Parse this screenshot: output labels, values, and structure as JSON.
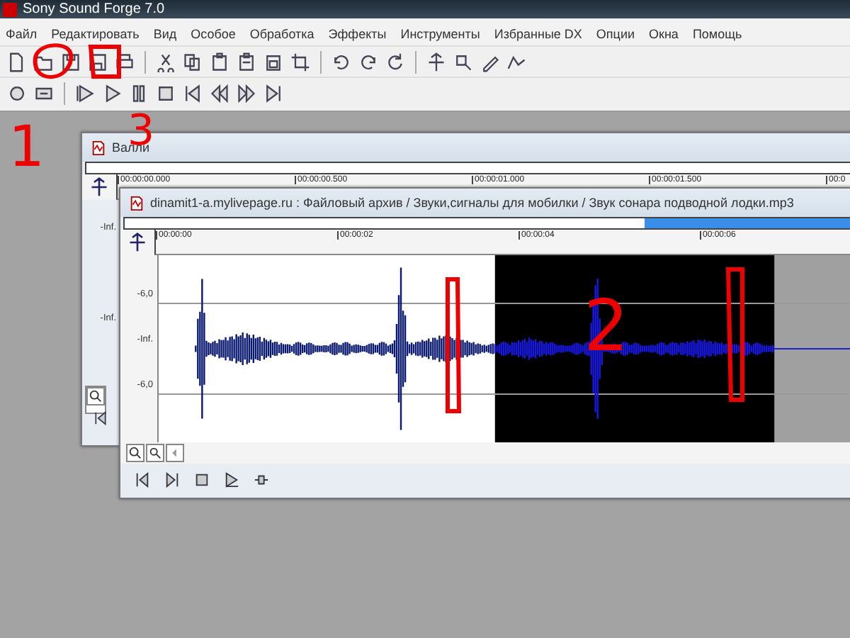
{
  "window": {
    "title": "Sony Sound Forge 7.0"
  },
  "menu": [
    "Файл",
    "Редактировать",
    "Вид",
    "Особое",
    "Обработка",
    "Эффекты",
    "Инструменты",
    "Избранные DX",
    "Опции",
    "Окна",
    "Помощь"
  ],
  "back_window": {
    "title": "Валли",
    "ruler": [
      "00:00:00.000",
      "00:00:00.500",
      "00:00:01.000",
      "00:00:01.500",
      "00:0"
    ],
    "levels": [
      "-Inf.",
      "-Inf."
    ]
  },
  "front_window": {
    "title": "dinamit1-a.mylivepage.ru : Файловый архив / Звуки,сигналы для мобилки / Звук сонара подводной лодки.mp3",
    "ruler": [
      "00:00:00",
      "00:00:02",
      "00:00:04",
      "00:00:06"
    ],
    "levels": [
      "-6,0",
      "-Inf.",
      "-6,0"
    ]
  },
  "annotations": [
    {
      "text": "1"
    },
    {
      "text": "3"
    },
    {
      "text": "2"
    }
  ]
}
